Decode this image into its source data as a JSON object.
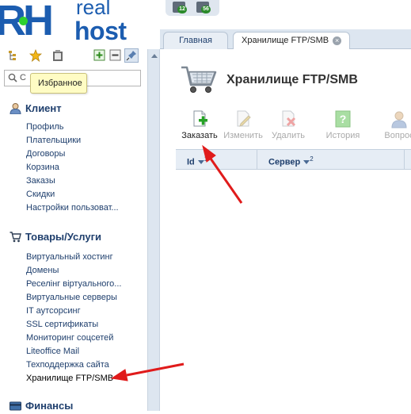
{
  "brand": {
    "logo_mark": "RH",
    "logo_real": "real",
    "logo_host": "host"
  },
  "top_icons": [
    {
      "name": "notifications-icon",
      "badge": "12"
    },
    {
      "name": "messages-icon",
      "badge": "56"
    }
  ],
  "sidebar": {
    "toolbar_icons": [
      "tree-icon",
      "star-icon",
      "clipboard-icon",
      "expand-icon",
      "collapse-icon",
      "pin-icon"
    ],
    "tooltip": "Избранное",
    "search_partial": "С",
    "sections": [
      {
        "title": "Клиент",
        "icon": "user-icon",
        "items": [
          "Профиль",
          "Плательщики",
          "Договоры",
          "Корзина",
          "Заказы",
          "Скидки",
          "Настройки пользоват..."
        ]
      },
      {
        "title": "Товары/Услуги",
        "icon": "cart-icon",
        "items": [
          "Виртуальный хостинг",
          "Домены",
          "Реселінг віртуального...",
          "Виртуальные серверы",
          "IT аутсорсинг",
          "SSL сертификаты",
          "Мониторинг соцсетей",
          "Liteoffice Mail",
          "Техподдержка сайта",
          "Хранилище FTP/SMB"
        ]
      },
      {
        "title": "Финансы",
        "icon": "finance-icon",
        "items": []
      }
    ]
  },
  "tabs": [
    {
      "label": "Главная"
    },
    {
      "label": "Хранилище FTP/SMB",
      "close": "×"
    }
  ],
  "page": {
    "title": "Хранилище FTP/SMB",
    "actions": [
      {
        "label": "Заказать",
        "icon": "order-icon",
        "enabled": true
      },
      {
        "label": "Изменить",
        "icon": "edit-icon",
        "enabled": false
      },
      {
        "label": "Удалить",
        "icon": "delete-icon",
        "enabled": false
      },
      {
        "label": "История",
        "icon": "history-icon",
        "enabled": false
      },
      {
        "label": "Вопрос",
        "icon": "question-icon",
        "enabled": false
      }
    ],
    "columns": [
      {
        "label": "Id",
        "sort_index": "1"
      },
      {
        "label": "Сервер",
        "sort_index": "2"
      }
    ]
  },
  "colors": {
    "accent": "#1c5db0",
    "link": "#1f3f6d",
    "annotation": "#e01b1b",
    "logo_dot": "#2ed12e"
  }
}
